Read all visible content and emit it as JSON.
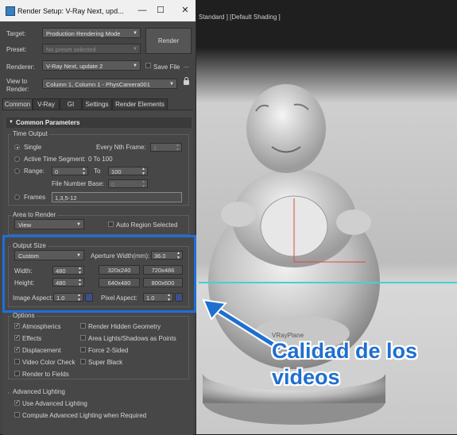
{
  "window": {
    "title": "Render Setup: V-Ray Next, upd...",
    "minimize_glyph": "—",
    "maximize_glyph": "☐",
    "close_glyph": "✕"
  },
  "viewport": {
    "label": "Standard ] [Default Shading ]",
    "watermark": "VRayPlane"
  },
  "header": {
    "target_label": "Target:",
    "target_value": "Production Rendering Mode",
    "preset_label": "Preset:",
    "preset_value": "No preset selected",
    "renderer_label": "Renderer:",
    "renderer_value": "V-Ray Next, update 2",
    "save_file_label": "Save File",
    "save_file_dots": "...",
    "view_label_1": "View to",
    "view_label_2": "Render:",
    "view_value": "Column 1, Column 1 - PhysCamera001",
    "render_button": "Render"
  },
  "tabs": [
    "Common",
    "V-Ray",
    "GI",
    "Settings",
    "Render Elements"
  ],
  "common_parameters": {
    "rollout_title": "Common Parameters",
    "time_output": {
      "title": "Time Output",
      "single": "Single",
      "every_nth_label": "Every Nth Frame:",
      "every_nth_value": "1",
      "active_segment": "Active Time Segment:",
      "active_segment_value": "0 To 100",
      "range_label": "Range:",
      "range_from": "0",
      "range_to_label": "To",
      "range_to": "100",
      "file_number_base_label": "File Number Base:",
      "file_number_base_value": "0",
      "frames_label": "Frames",
      "frames_value": "1,3,5-12"
    },
    "area_to_render": {
      "title": "Area to Render",
      "value": "View",
      "auto_region": "Auto Region Selected"
    },
    "output_size": {
      "title": "Output Size",
      "preset": "Custom",
      "aperture_label": "Aperture Width(mm):",
      "aperture_value": "36.0",
      "width_label": "Width:",
      "width_value": "480",
      "height_label": "Height:",
      "height_value": "480",
      "presets": [
        "320x240",
        "720x486",
        "640x480",
        "800x600"
      ],
      "image_aspect_label": "Image Aspect:",
      "image_aspect_value": "1.0",
      "pixel_aspect_label": "Pixel Aspect:",
      "pixel_aspect_value": "1.0"
    },
    "options": {
      "title": "Options",
      "items": [
        {
          "label": "Atmospherics",
          "checked": true
        },
        {
          "label": "Render Hidden Geometry",
          "checked": false
        },
        {
          "label": "Effects",
          "checked": true
        },
        {
          "label": "Area Lights/Shadows as Points",
          "checked": false
        },
        {
          "label": "Displacement",
          "checked": true
        },
        {
          "label": "Force 2-Sided",
          "checked": false
        },
        {
          "label": "Video Color Check",
          "checked": false
        },
        {
          "label": "Super Black",
          "checked": false
        },
        {
          "label": "Render to Fields",
          "checked": false
        }
      ]
    },
    "advanced_lighting": {
      "title": "Advanced Lighting",
      "use": "Use Advanced Lighting",
      "compute": "Compute Advanced Lighting when Required"
    }
  },
  "caption": {
    "line1": "Calidad de los",
    "line2": "videos",
    "color": "#1f6fd0"
  }
}
